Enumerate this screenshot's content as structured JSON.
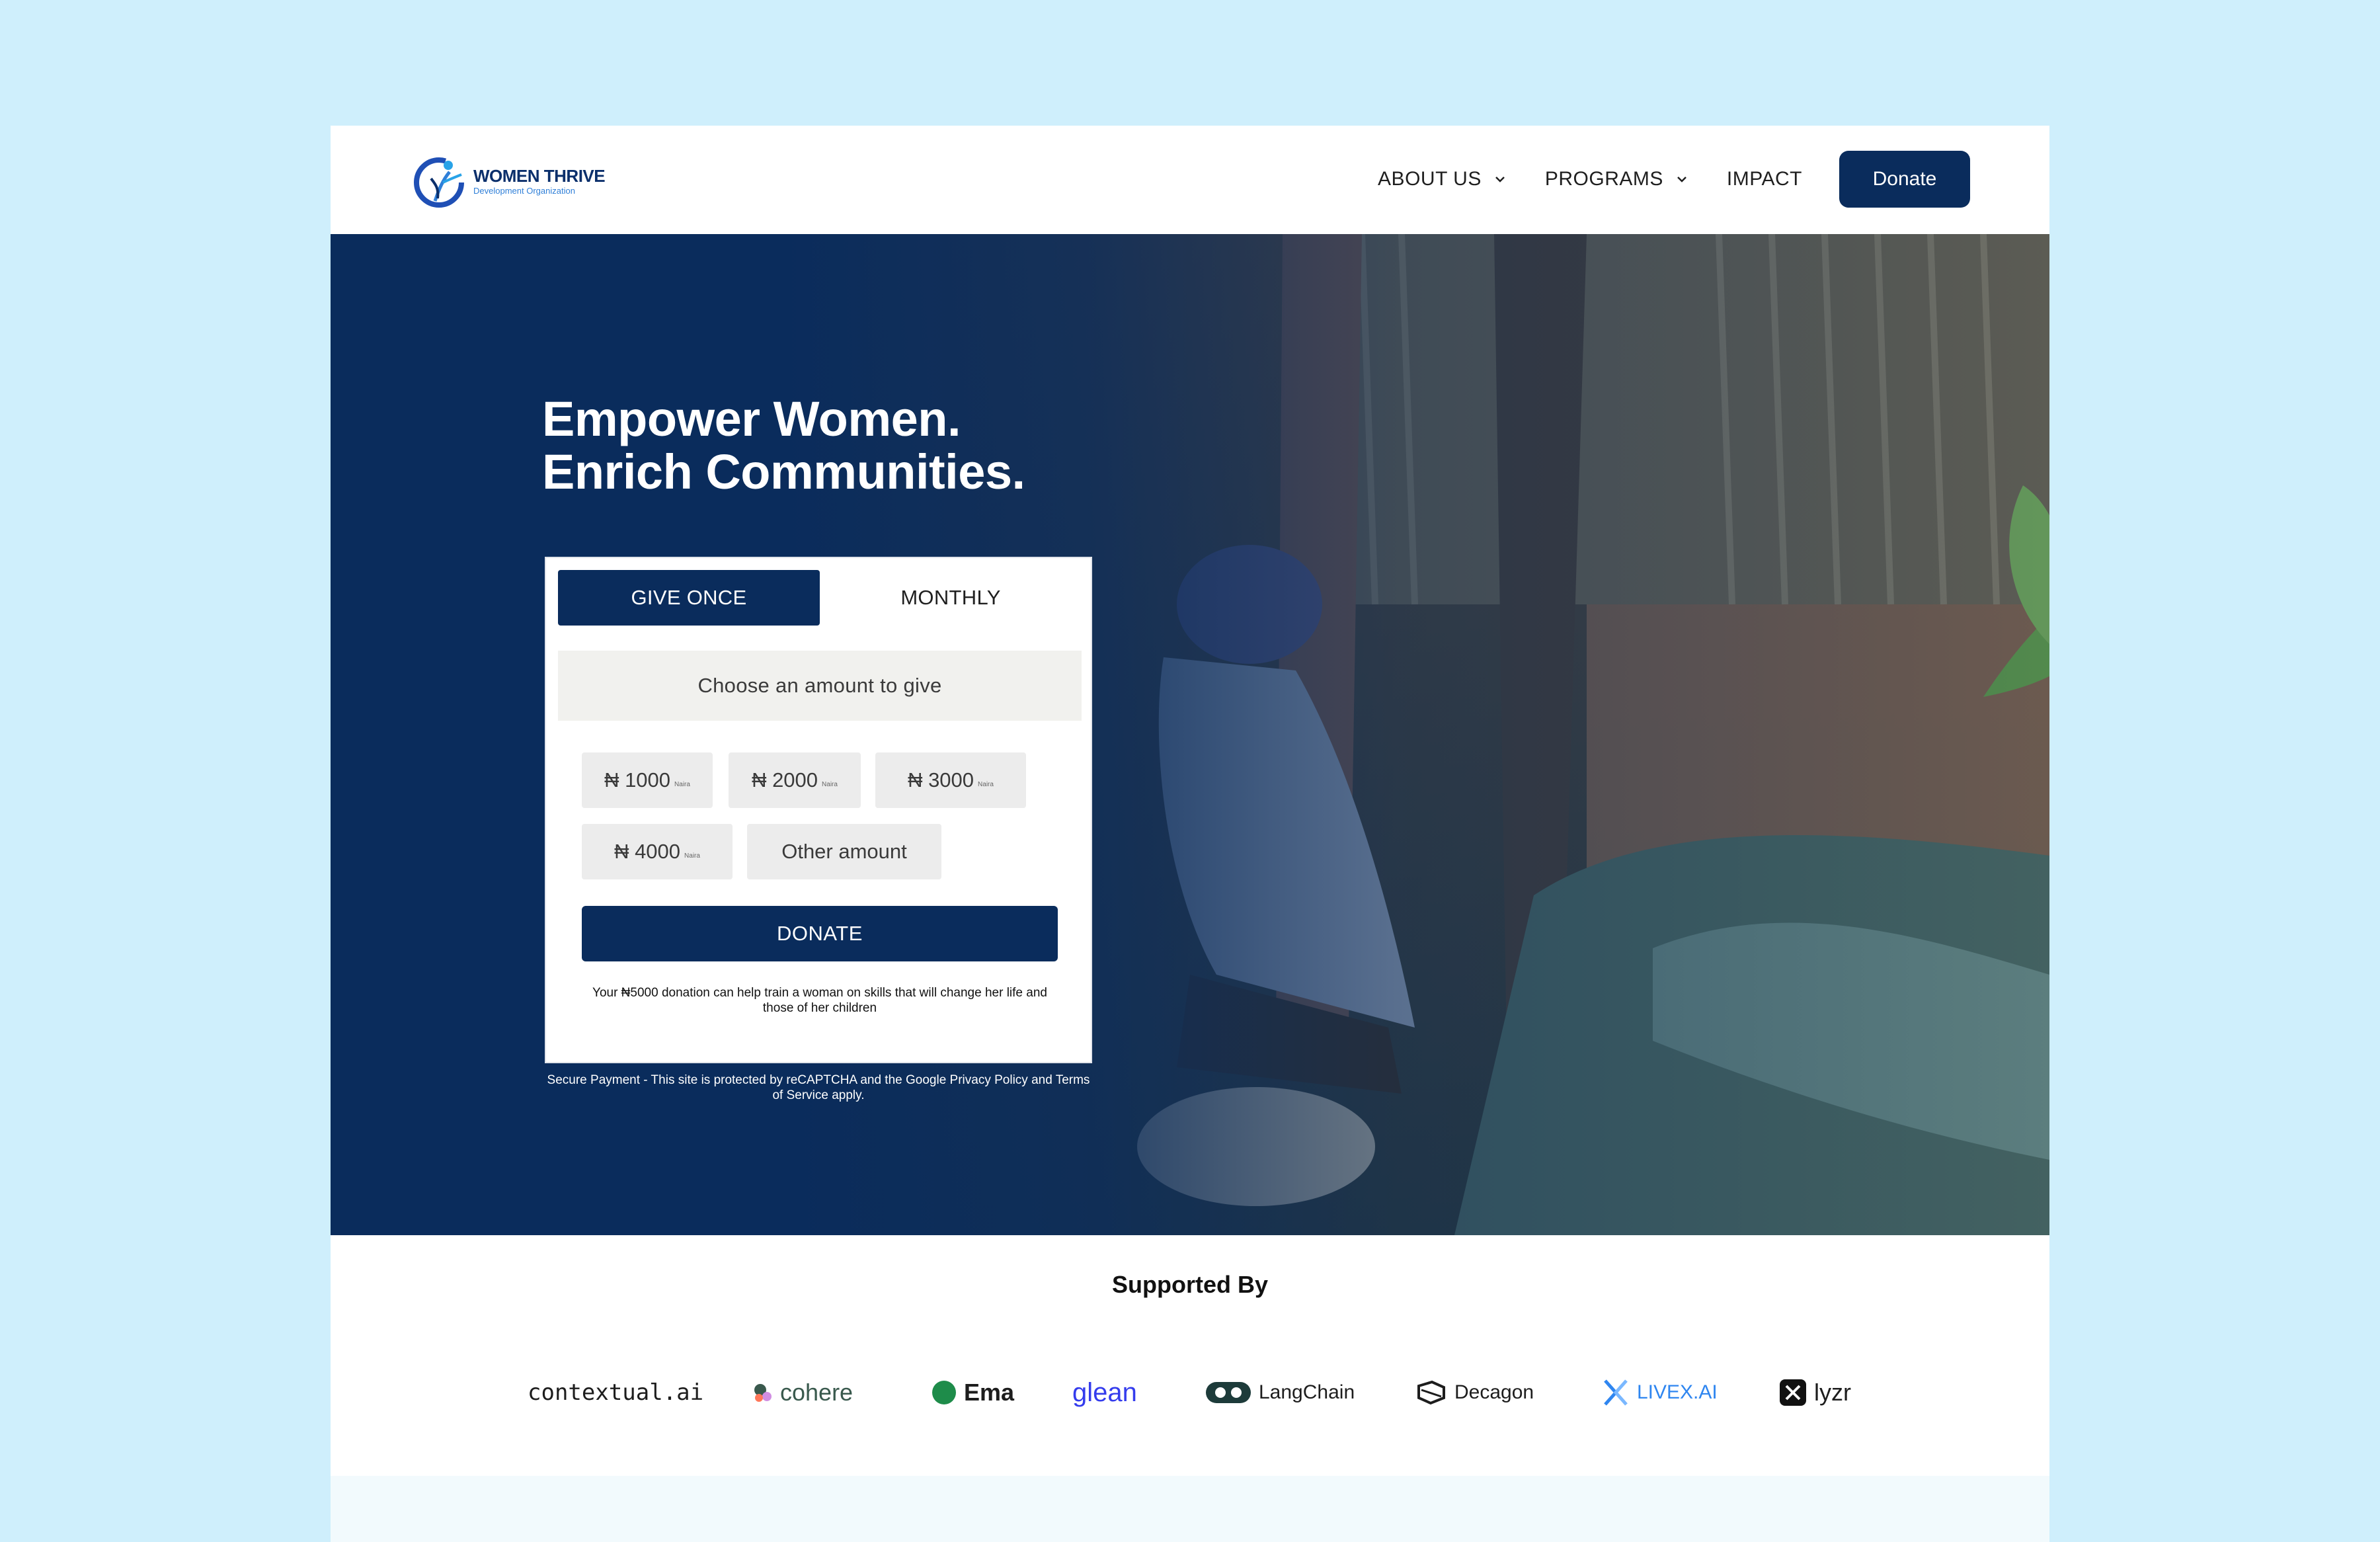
{
  "brand": {
    "name": "WOMEN THRIVE",
    "tagline": "Development Organization"
  },
  "nav": {
    "items": [
      {
        "label": "ABOUT US",
        "has_dropdown": true
      },
      {
        "label": "PROGRAMS",
        "has_dropdown": true
      },
      {
        "label": "IMPACT",
        "has_dropdown": false
      }
    ],
    "donate_label": "Donate"
  },
  "hero": {
    "title_line1": "Empower Women.",
    "title_line2": "Enrich Communities."
  },
  "donation": {
    "tabs": [
      {
        "label": "GIVE ONCE",
        "active": true
      },
      {
        "label": "MONTHLY",
        "active": false
      }
    ],
    "prompt": "Choose an amount to give",
    "amounts": [
      {
        "label": "₦ 1000",
        "unit": "Naira"
      },
      {
        "label": "₦ 2000",
        "unit": "Naira"
      },
      {
        "label": "₦ 3000",
        "unit": "Naira"
      },
      {
        "label": "₦ 4000",
        "unit": "Naira"
      }
    ],
    "other_label": "Other amount",
    "donate_label": "DONATE",
    "impact_note": "Your ₦5000 donation can help train a woman on skills that will change her life and those of her children",
    "secure_note": "Secure Payment - This site is protected by reCAPTCHA and the Google Privacy Policy and Terms of Service apply."
  },
  "supported": {
    "title": "Supported By",
    "logos": [
      {
        "name": "contextual.ai",
        "icon": "contextual-ai-logo"
      },
      {
        "name": "cohere",
        "icon": "cohere-logo"
      },
      {
        "name": "Ema",
        "icon": "ema-logo"
      },
      {
        "name": "glean",
        "icon": "glean-logo"
      },
      {
        "name": "LangChain",
        "icon": "langchain-logo"
      },
      {
        "name": "Decagon",
        "icon": "decagon-logo"
      },
      {
        "name": "LIVEX.AI",
        "icon": "livex-logo"
      },
      {
        "name": "lyzr",
        "icon": "lyzr-logo"
      }
    ]
  },
  "colors": {
    "background": "#cfeffc",
    "primary": "#0a2c5c",
    "button_gray": "#ececec",
    "prompt_bg": "#f1f1ee"
  }
}
